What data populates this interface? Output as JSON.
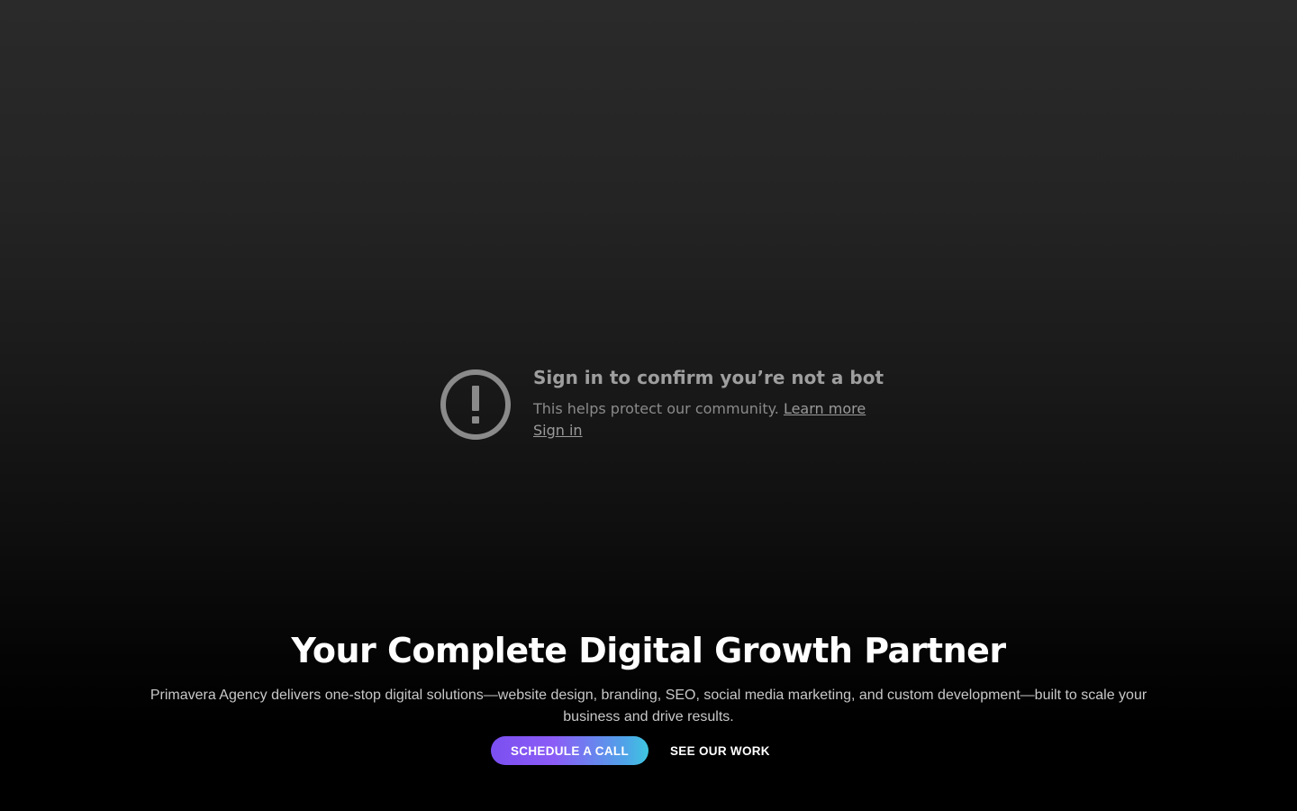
{
  "bot_notice": {
    "title": "Sign in to confirm you’re not a bot",
    "body": "This helps protect our community.",
    "learn_more": "Learn more",
    "sign_in": "Sign in",
    "icon": "warning-icon"
  },
  "hero": {
    "headline": "Your Complete Digital Growth Partner",
    "description": "Primavera Agency delivers one-stop digital solutions—website design, branding, SEO, social media marketing, and custom development—built to scale your business and drive results.",
    "primary_cta": "SCHEDULE A CALL",
    "secondary_cta": "SEE OUR WORK"
  },
  "colors": {
    "cta_gradient_start": "#7b4ff0",
    "cta_gradient_end": "#3ec6e0",
    "notice_text": "#9e9e9e"
  }
}
